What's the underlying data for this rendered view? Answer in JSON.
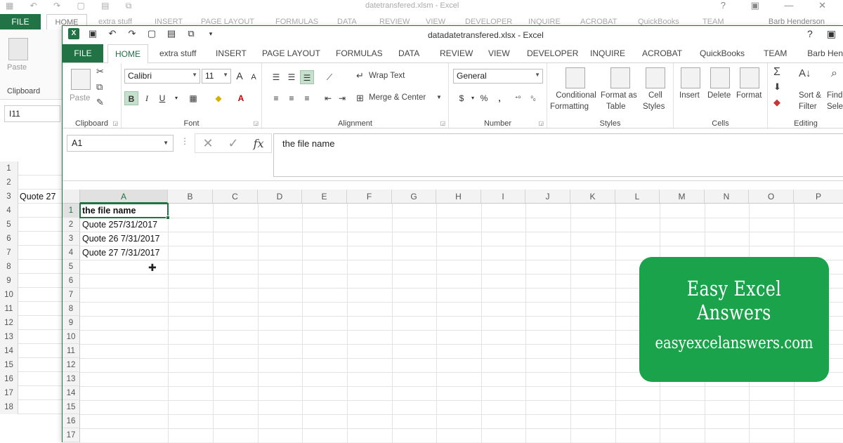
{
  "background_window": {
    "title": "datetransfered.xlsm - Excel",
    "tabs": [
      "FILE",
      "HOME",
      "extra stuff",
      "INSERT",
      "PAGE LAYOUT",
      "FORMULAS",
      "DATA",
      "REVIEW",
      "VIEW",
      "DEVELOPER",
      "INQUIRE",
      "ACROBAT",
      "QuickBooks",
      "TEAM"
    ],
    "user": "Barb Henderson",
    "paste_label": "Paste",
    "clipboard_label": "Clipboard",
    "name_box": "I11",
    "row_numbers": [
      "1",
      "2",
      "3",
      "4",
      "5",
      "6",
      "7",
      "8",
      "9",
      "10",
      "11",
      "12",
      "13",
      "14",
      "15",
      "16",
      "17",
      "18"
    ],
    "row3_value": "Quote 27"
  },
  "window": {
    "title": "datadatetransfered.xlsx - Excel",
    "tabs": {
      "file": "FILE",
      "home": "HOME",
      "extra": "extra stuff",
      "insert": "INSERT",
      "page_layout": "PAGE LAYOUT",
      "formulas": "FORMULAS",
      "data": "DATA",
      "review": "REVIEW",
      "view": "VIEW",
      "developer": "DEVELOPER",
      "inquire": "INQUIRE",
      "acrobat": "ACROBAT",
      "quickbooks": "QuickBooks",
      "team": "TEAM"
    },
    "user": "Barb Hen"
  },
  "ribbon": {
    "clipboard": {
      "paste": "Paste",
      "label": "Clipboard"
    },
    "font": {
      "name": "Calibri",
      "size": "11",
      "label": "Font",
      "bold": "B",
      "italic": "I",
      "underline": "U",
      "grow": "A",
      "shrink": "A"
    },
    "alignment": {
      "wrap": "Wrap Text",
      "merge": "Merge & Center",
      "label": "Alignment"
    },
    "number": {
      "format": "General",
      "currency": "$",
      "percent": "%",
      "comma": ",",
      "label": "Number"
    },
    "styles": {
      "conditional": [
        "Conditional",
        "Formatting"
      ],
      "format_table": [
        "Format as",
        "Table"
      ],
      "cell_styles": [
        "Cell",
        "Styles"
      ],
      "label": "Styles"
    },
    "cells": {
      "insert": "Insert",
      "delete": "Delete",
      "format": "Format",
      "label": "Cells"
    },
    "editing": {
      "sort": [
        "Sort &",
        "Filter"
      ],
      "find": [
        "Find",
        "Selec"
      ],
      "label": "Editing"
    }
  },
  "formula_bar": {
    "name_box": "A1",
    "content": "the file name",
    "fx": "fx"
  },
  "sheet": {
    "columns": [
      "A",
      "B",
      "C",
      "D",
      "E",
      "F",
      "G",
      "H",
      "I",
      "J",
      "K",
      "L",
      "M",
      "N",
      "O",
      "P"
    ],
    "rows": [
      "1",
      "2",
      "3",
      "4",
      "5",
      "6",
      "7",
      "8",
      "9",
      "10",
      "11",
      "12",
      "13",
      "14",
      "15",
      "16",
      "17"
    ],
    "cells": {
      "a1": "the file name",
      "a2": "Quote 257/31/2017",
      "a3": "Quote 26  7/31/2017",
      "a4": "Quote 27  7/31/2017"
    }
  },
  "watermark": {
    "line1": "Easy  Excel  Answers",
    "line2": "easyexcelanswers.com",
    "color": "#1aa34a"
  },
  "colors": {
    "excel_green": "#217346"
  }
}
